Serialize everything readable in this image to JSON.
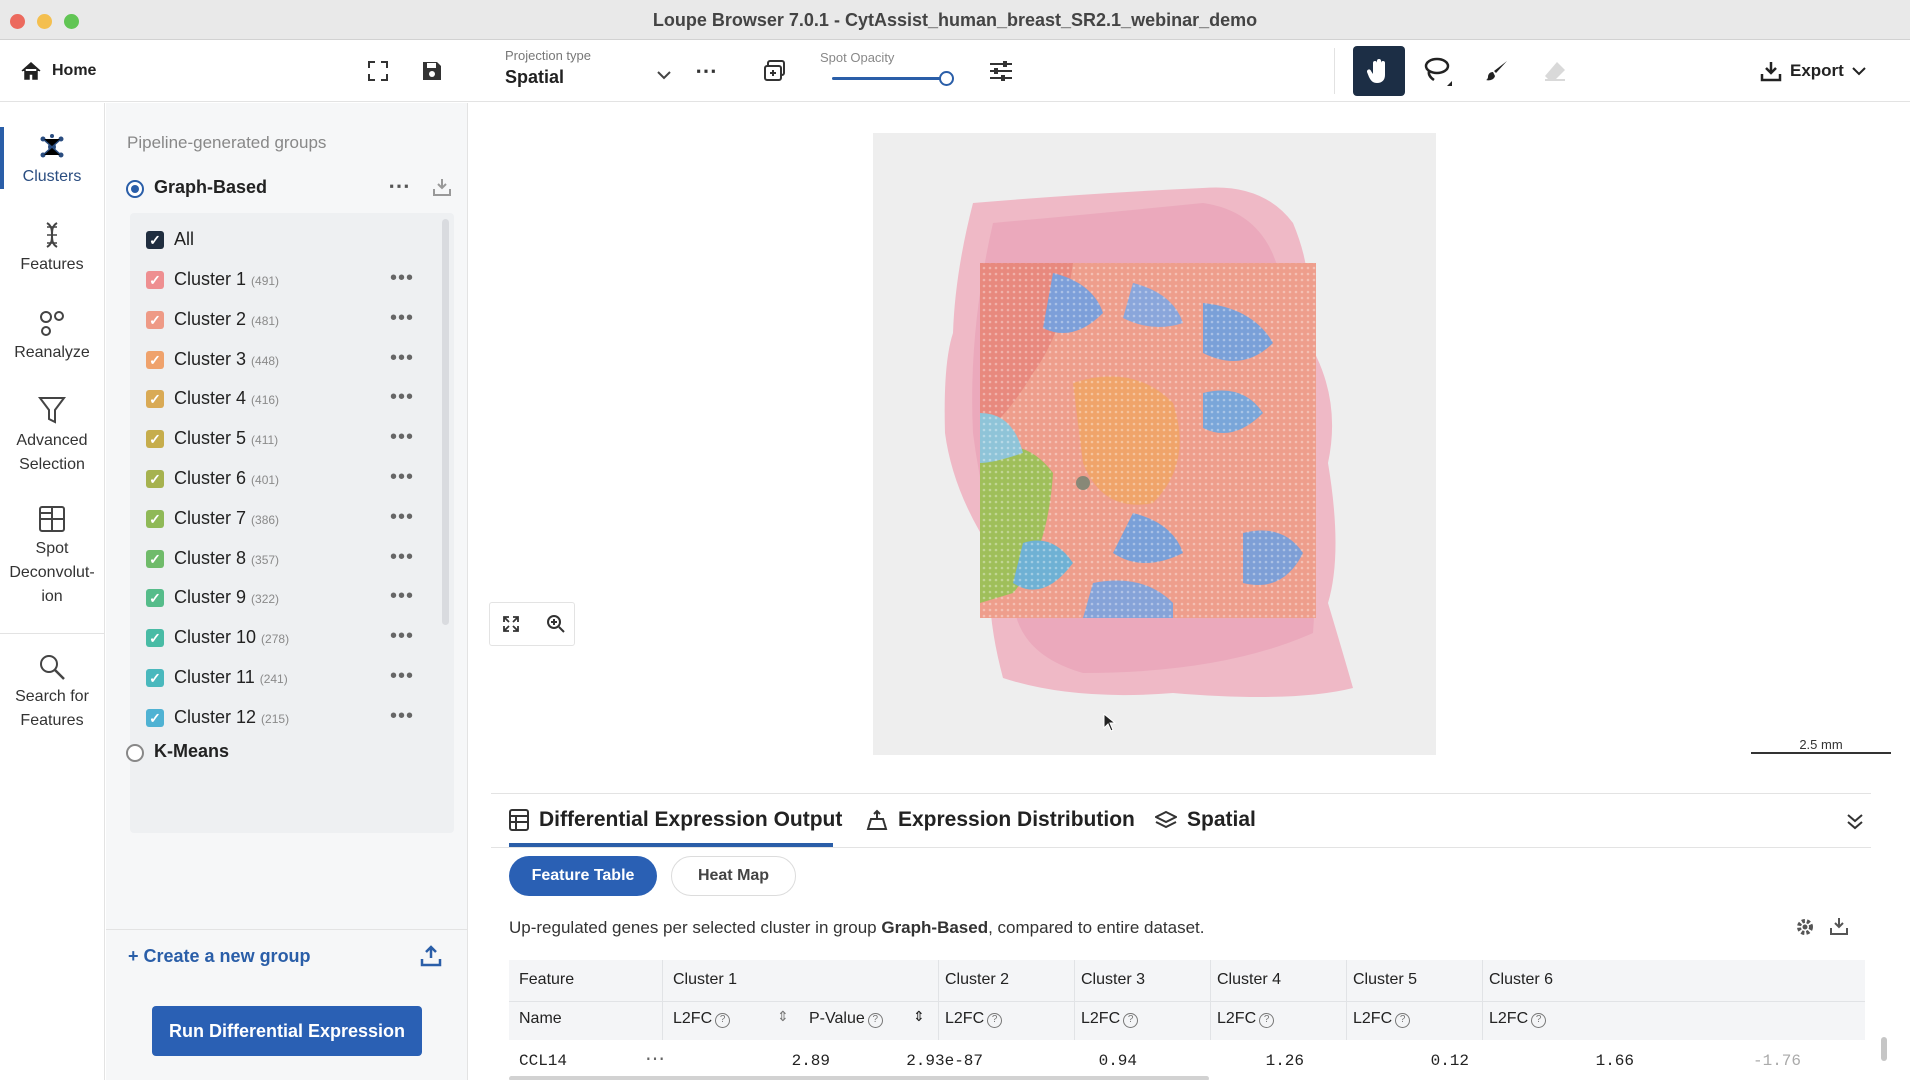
{
  "window": {
    "title": "Loupe Browser 7.0.1 - CytAssist_human_breast_SR2.1_webinar_demo"
  },
  "toolbar": {
    "home_label": "Home",
    "projection_label": "Projection type",
    "projection_value": "Spatial",
    "opacity_label": "Spot Opacity",
    "opacity_level": 1.0,
    "export_label": "Export"
  },
  "rail": {
    "clusters": "Clusters",
    "features": "Features",
    "reanalyze": "Reanalyze",
    "advanced1": "Advanced",
    "advanced2": "Selection",
    "spot1": "Spot",
    "spot2": "Deconvolut-",
    "spot3": "ion",
    "search1": "Search for",
    "search2": "Features"
  },
  "groups": {
    "section_title": "Pipeline-generated groups",
    "graph_based": "Graph-Based",
    "all_label": "All",
    "clusters": [
      {
        "name": "Cluster 1",
        "count": "(491)",
        "color": "#ee8f91"
      },
      {
        "name": "Cluster 2",
        "count": "(481)",
        "color": "#ee9a86"
      },
      {
        "name": "Cluster 3",
        "count": "(448)",
        "color": "#efa26c"
      },
      {
        "name": "Cluster 4",
        "count": "(416)",
        "color": "#d9aa55"
      },
      {
        "name": "Cluster 5",
        "count": "(411)",
        "color": "#c6ad4c"
      },
      {
        "name": "Cluster 6",
        "count": "(401)",
        "color": "#a6b24f"
      },
      {
        "name": "Cluster 7",
        "count": "(386)",
        "color": "#8fb957"
      },
      {
        "name": "Cluster 8",
        "count": "(357)",
        "color": "#6fbb6a"
      },
      {
        "name": "Cluster 9",
        "count": "(322)",
        "color": "#55bc8a"
      },
      {
        "name": "Cluster 10",
        "count": "(278)",
        "color": "#48bba5"
      },
      {
        "name": "Cluster 11",
        "count": "(241)",
        "color": "#49b8bd"
      },
      {
        "name": "Cluster 12",
        "count": "(215)",
        "color": "#4fb2d3"
      }
    ],
    "kmeans": "K-Means",
    "create_group": "Create a new group",
    "run_de": "Run Differential Expression"
  },
  "viewer": {
    "scale": "2.5 mm"
  },
  "bottom": {
    "tabs": [
      "Differential Expression Output",
      "Expression Distribution",
      "Spatial"
    ],
    "pill_feature_table": "Feature Table",
    "pill_heat_map": "Heat Map",
    "desc_pre": "Up-regulated genes per selected cluster in group ",
    "desc_bold": "Graph-Based",
    "desc_post": ", compared to entire dataset.",
    "table": {
      "col_feature": "Feature",
      "col_name": "Name",
      "clusters": [
        "Cluster 1",
        "Cluster 2",
        "Cluster 3",
        "Cluster 4",
        "Cluster 5",
        "Cluster 6"
      ],
      "l2fc": "L2FC",
      "pvalue": "P-Value",
      "row": {
        "name": "CCL14",
        "c1_l2fc": "2.89",
        "c1_p": "2.93e-87",
        "c2": "0.94",
        "c3": "1.26",
        "c4": "0.12",
        "c5": "1.66",
        "c6": "-1.76"
      }
    }
  }
}
